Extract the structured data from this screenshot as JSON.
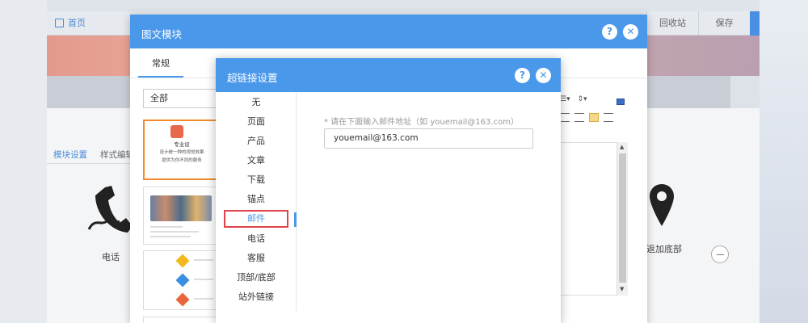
{
  "background": {
    "home_label": "首页",
    "recycle_label": "回收站",
    "save_label": "保存",
    "tab_module_settings": "模块设置",
    "tab_style_edit": "样式编辑",
    "phone_label": "电话",
    "add_bottom_label": "返加底部"
  },
  "outer_modal": {
    "title": "图文模块",
    "tab": "常规",
    "category_select": "全部",
    "thumb1": {
      "line1": "专业设",
      "line2": "设计统一种的视觉效果",
      "line3": "提供为你不同的服务"
    }
  },
  "link_modal": {
    "title": "超链接设置",
    "menu": [
      {
        "label": "无"
      },
      {
        "label": "页面"
      },
      {
        "label": "产品"
      },
      {
        "label": "文章"
      },
      {
        "label": "下载"
      },
      {
        "label": "锚点"
      },
      {
        "label": "邮件"
      },
      {
        "label": "电话"
      },
      {
        "label": "客服"
      },
      {
        "label": "顶部/底部"
      },
      {
        "label": "站外链接"
      }
    ],
    "selected": "邮件",
    "hint": "* 请在下面输入邮件地址（如 youemail@163.com）",
    "email_value": "youemail@163.com"
  },
  "colors": {
    "header_blue": "#4a98ea",
    "selection_red": "#e0434a",
    "thumb_orange": "#f2892d"
  }
}
